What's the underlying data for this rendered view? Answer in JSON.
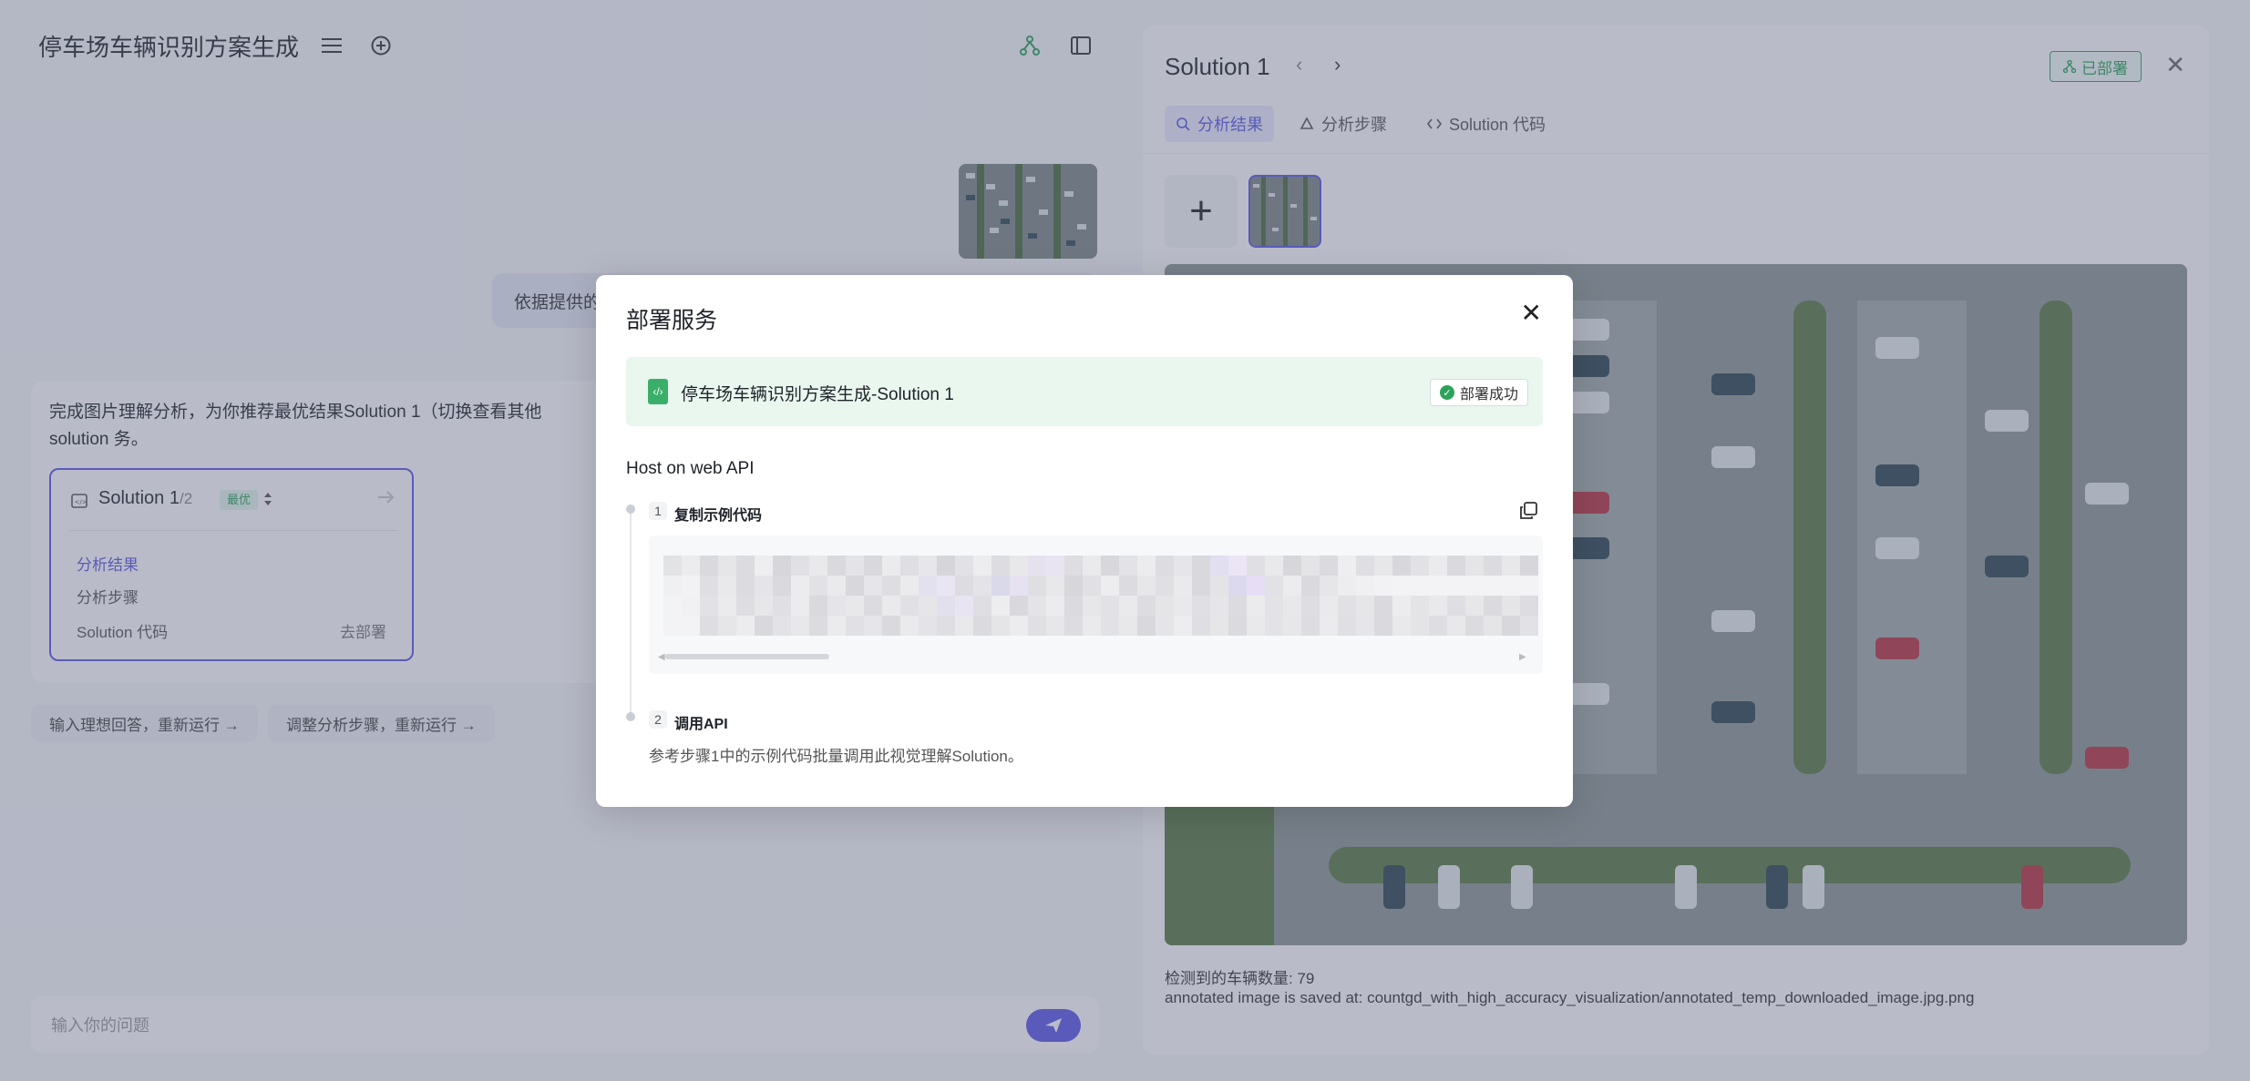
{
  "app": {
    "title": "停车场车辆识别方案生成",
    "chat_input_placeholder": "输入你的问题"
  },
  "chat": {
    "user_message": "依据提供的",
    "answer_text": "完成图片理解分析，为你推荐最优结果Solution 1（切换查看其他 solution 务。",
    "solution_card": {
      "title": "Solution 1",
      "count": "/2",
      "badge": "最优",
      "items": [
        "分析结果",
        "分析步骤",
        "Solution 代码"
      ],
      "deploy_link": "去部署"
    },
    "suggestion_chips": [
      "输入理想回答，重新运行 →",
      "调整分析步骤，重新运行 →"
    ]
  },
  "panel": {
    "title": "Solution 1",
    "deployed_label": "已部署",
    "tabs": [
      "分析结果",
      "分析步骤",
      "Solution 代码"
    ],
    "active_tab": "分析结果",
    "result_lines": [
      "检测到的车辆数量: 79",
      "annotated image is saved at: countgd_with_high_accuracy_visualization/annotated_temp_downloaded_image.jpg.png"
    ]
  },
  "modal": {
    "title": "部署服务",
    "service_name": "停车场车辆识别方案生成-Solution 1",
    "service_status": "部署成功",
    "host_label": "Host on web API",
    "steps": [
      {
        "num": "1",
        "title": "复制示例代码"
      },
      {
        "num": "2",
        "title": "调用API",
        "desc": "参考步骤1中的示例代码批量调用此视觉理解Solution。"
      }
    ]
  },
  "colors": {
    "accent": "#5b57e6",
    "success": "#2ba35a",
    "success_bg": "#e9f7ef",
    "overlay": "rgba(88,95,125,0.42)"
  },
  "icons": [
    "menu-icon",
    "add-circle-icon",
    "share-tree-icon",
    "sidebar-toggle-icon",
    "send-icon",
    "close-icon",
    "copy-icon",
    "code-file-icon",
    "check-circle-icon",
    "chevron-left-icon",
    "chevron-right-icon",
    "sort-icon",
    "arrow-right-icon"
  ]
}
